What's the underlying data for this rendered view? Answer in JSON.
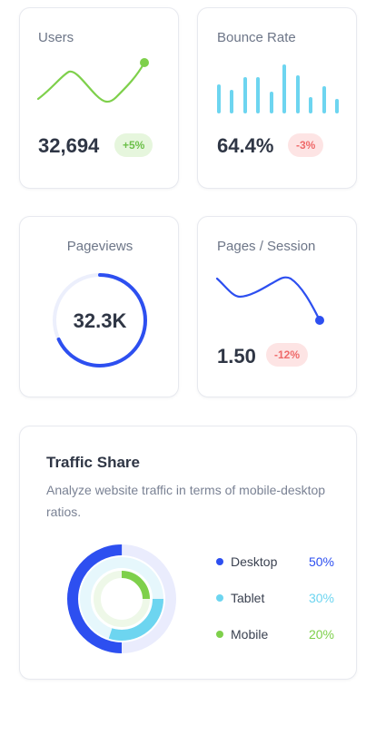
{
  "colors": {
    "accent_green": "#7ed04b",
    "accent_cyan": "#6dd5f0",
    "accent_blue": "#2d4ff0"
  },
  "users_card": {
    "title": "Users",
    "value": "32,694",
    "change": "+5%"
  },
  "bounce_card": {
    "title": "Bounce Rate",
    "value": "64.4%",
    "change": "-3%"
  },
  "pageviews_card": {
    "title": "Pageviews",
    "value": "32.3K",
    "progress": 0.68
  },
  "pages_session_card": {
    "title": "Pages / Session",
    "value": "1.50",
    "change": "-12%"
  },
  "traffic_card": {
    "title": "Traffic Share",
    "description": "Analyze website traffic in terms of mobile-desktop ratios.",
    "legend": [
      {
        "label": "Desktop",
        "percent": "50%",
        "color": "#2d4ff0"
      },
      {
        "label": "Tablet",
        "percent": "30%",
        "color": "#6dd5f0"
      },
      {
        "label": "Mobile",
        "percent": "20%",
        "color": "#7ed04b"
      }
    ]
  }
}
